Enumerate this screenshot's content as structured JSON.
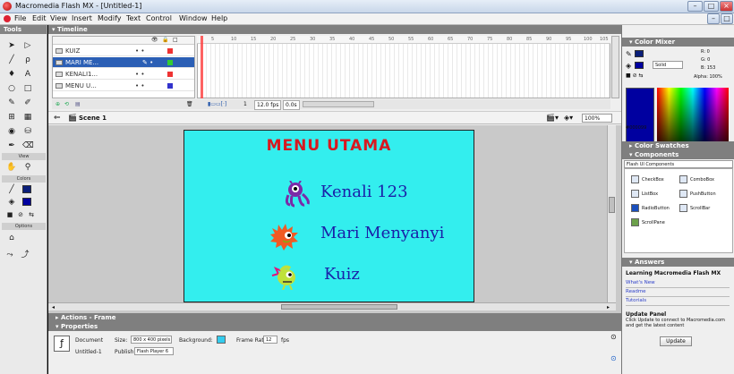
{
  "window": {
    "title": "Macromedia Flash MX - [Untitled-1]"
  },
  "menu": [
    "File",
    "Edit",
    "View",
    "Insert",
    "Modify",
    "Text",
    "Control",
    "Window",
    "Help"
  ],
  "tools": {
    "header": "Tools",
    "view_label": "View",
    "colors_label": "Colors",
    "options_label": "Options"
  },
  "timeline": {
    "header": "Timeline",
    "layers": [
      {
        "name": "KUIZ"
      },
      {
        "name": "MARI ME..."
      },
      {
        "name": "KENALI1..."
      },
      {
        "name": "MENU U..."
      }
    ],
    "ruler": [
      "5",
      "10",
      "15",
      "20",
      "25",
      "30",
      "35",
      "40",
      "45",
      "50",
      "55",
      "60",
      "65",
      "70",
      "75",
      "80",
      "85",
      "90",
      "95",
      "100",
      "105"
    ],
    "frame": "1",
    "fps": "12.0 fps",
    "time": "0.0s"
  },
  "scene": {
    "label": "Scene 1",
    "zoom": "100%"
  },
  "stage": {
    "title": "MENU UTAMA",
    "items": [
      "Kenali 123",
      "Mari Menyanyi",
      "Kuiz"
    ],
    "colors": {
      "background": "#33eeee",
      "title": "#d71920",
      "items": "#1a20a8"
    }
  },
  "actions": {
    "header": "Actions - Frame"
  },
  "properties": {
    "header": "Properties",
    "doc_type": "Document",
    "doc_name": "Untitled-1",
    "size_label": "Size:",
    "size_value": "800 x 400 pixels",
    "background_label": "Background:",
    "frame_rate_label": "Frame Rate:",
    "frame_rate_value": "12",
    "fps_unit": "fps",
    "publish_label": "Publish:",
    "publish_value": "Flash Player 6"
  },
  "color_mixer": {
    "header": "Color Mixer",
    "mode": "Solid",
    "r": "R: 0",
    "g": "G: 0",
    "b": "B: 153",
    "alpha": "Alpha: 100%",
    "hex": "#000099"
  },
  "color_swatches": {
    "header": "Color Swatches"
  },
  "components": {
    "header": "Components",
    "set": "Flash UI Components",
    "items": [
      "CheckBox",
      "ComboBox",
      "ListBox",
      "PushButton",
      "RadioButton",
      "ScrollBar",
      "ScrollPane"
    ]
  },
  "answers": {
    "header": "Answers",
    "title": "Learning Macromedia Flash MX",
    "links": [
      "What's New",
      "Readme",
      "Tutorials"
    ],
    "update_title": "Update Panel",
    "update_text": "Click Update to connect to Macromedia.com and get the latest content",
    "update_button": "Update"
  }
}
